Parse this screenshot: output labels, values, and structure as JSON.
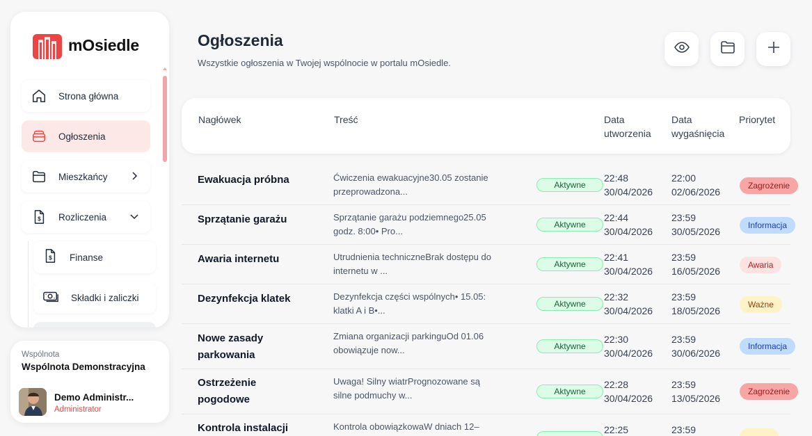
{
  "app": {
    "name": "mOsiedle",
    "brand_color": "#ef4444"
  },
  "sidebar": {
    "items": [
      {
        "label": "Strona główna",
        "icon": "home-icon"
      },
      {
        "label": "Ogłoszenia",
        "icon": "layers-icon",
        "active": true
      },
      {
        "label": "Mieszkańcy",
        "icon": "folder-icon"
      },
      {
        "label": "Rozliczenia",
        "icon": "document-dollar-icon"
      }
    ],
    "subitems": [
      {
        "label": "Finanse",
        "icon": "document-dollar-icon"
      },
      {
        "label": "Składki i zaliczki",
        "icon": "cash-icon"
      }
    ]
  },
  "community": {
    "label": "Wspólnota",
    "name": "Wspólnota Demonstracyjna",
    "user_name": "Demo Administr...",
    "user_role": "Administrator"
  },
  "header": {
    "title": "Ogłoszenia",
    "subtitle": "Wszystkie ogłoszenia w Twojej wspólnocie w portalu mOsiedle."
  },
  "table": {
    "columns": {
      "heading": "Nagłówek",
      "content": "Treść",
      "created_1": "Data",
      "created_2": "utworzenia",
      "expires_1": "Data",
      "expires_2": "wygaśnięcia",
      "priority": "Priorytet"
    },
    "rows": [
      {
        "title": "Ewakuacja próbna",
        "content_1": "Ćwiczenia ewakuacyjne30.05 zostanie",
        "content_2": "przeprowadzona...",
        "status": "Aktywne",
        "created_time": "22:48",
        "created_date": "30/04/2026",
        "expires_time": "22:00",
        "expires_date": "02/06/2026",
        "priority": "Zagrożenie"
      },
      {
        "title": "Sprzątanie garażu",
        "content_1": "Sprzątanie garażu podziemnego25.05",
        "content_2": "godz. 8:00• Pro...",
        "status": "Aktywne",
        "created_time": "22:44",
        "created_date": "30/04/2026",
        "expires_time": "23:59",
        "expires_date": "30/05/2026",
        "priority": "Informacja"
      },
      {
        "title": "Awaria internetu",
        "content_1": "Utrudnienia techniczneBrak dostępu do",
        "content_2": "internetu w ...",
        "status": "Aktywne",
        "created_time": "22:41",
        "created_date": "30/04/2026",
        "expires_time": "23:59",
        "expires_date": "16/05/2026",
        "priority": "Awaria"
      },
      {
        "title": "Dezynfekcja klatek",
        "content_1": "Dezynfekcja części wspólnych• 15.05:",
        "content_2": "klatki A i B•...",
        "status": "Aktywne",
        "created_time": "22:32",
        "created_date": "30/04/2026",
        "expires_time": "23:59",
        "expires_date": "18/05/2026",
        "priority": "Ważne"
      },
      {
        "title_1": "Nowe zasady",
        "title_2": "parkowania",
        "content_1": "Zmiana organizacji parkinguOd 01.06",
        "content_2": "obowiązuje now...",
        "status": "Aktywne",
        "created_time": "22:30",
        "created_date": "30/04/2026",
        "expires_time": "23:59",
        "expires_date": "30/06/2026",
        "priority": "Informacja"
      },
      {
        "title_1": "Ostrzeżenie",
        "title_2": "pogodowe",
        "content_1": "Uwaga! Silny wiatrPrognozowane są",
        "content_2": "silne podmuchy w...",
        "status": "Aktywne",
        "created_time": "22:28",
        "created_date": "30/04/2026",
        "expires_time": "23:59",
        "expires_date": "13/05/2026",
        "priority": "Zagrożenie"
      },
      {
        "title": "Kontrola instalacji",
        "content_1": "Kontrola obowiązkowaW dniach 12–",
        "created_time": "22:25",
        "expires_time": "23:59"
      }
    ]
  }
}
